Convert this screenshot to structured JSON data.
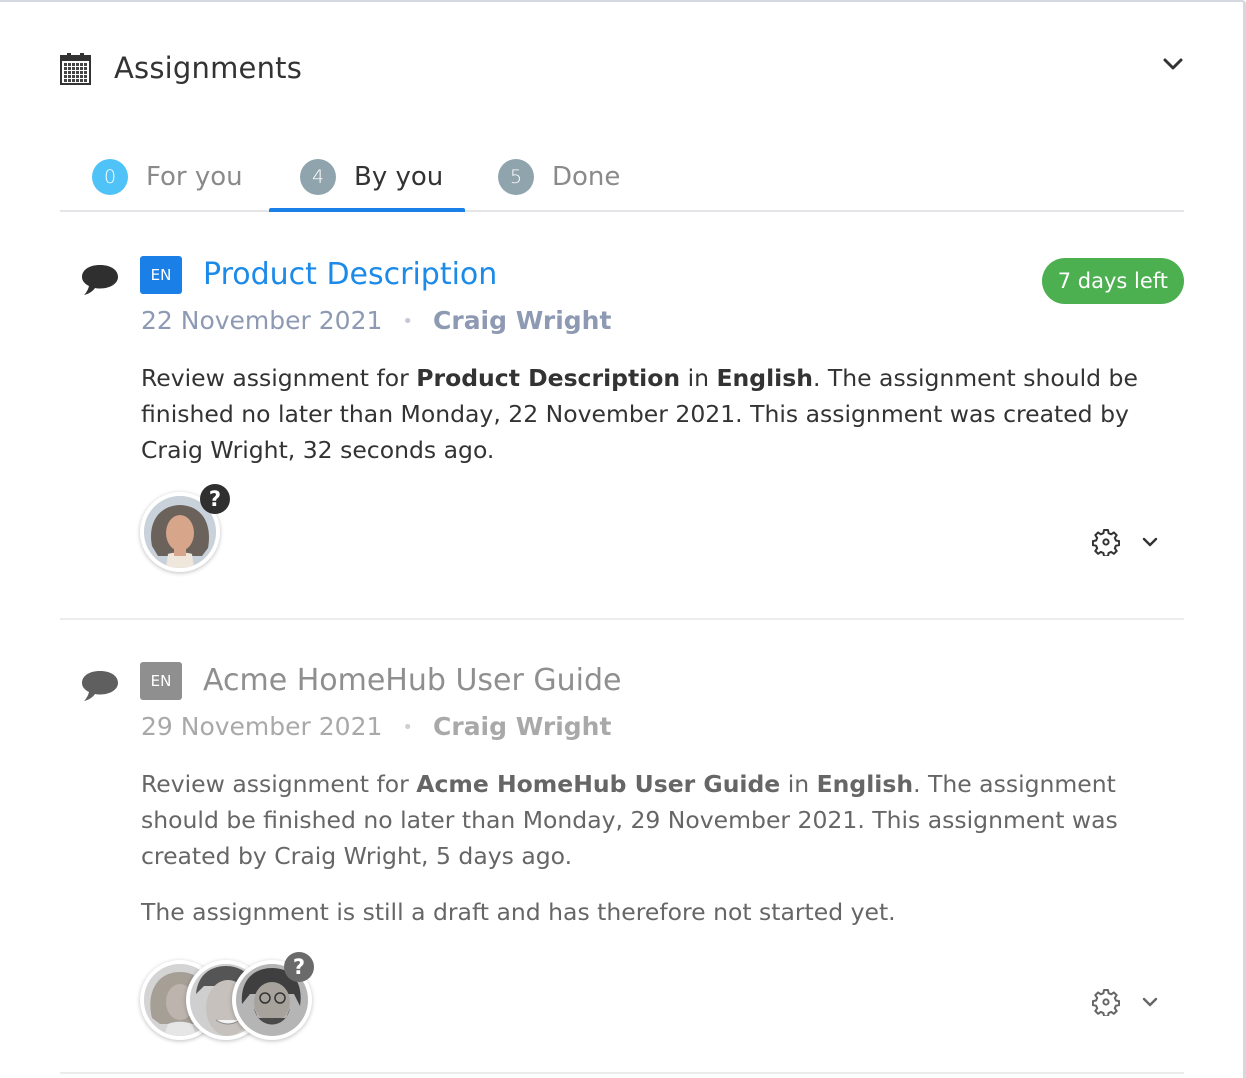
{
  "header": {
    "title": "Assignments",
    "icon": "calendar-icon",
    "collapse_icon": "chevron-down-icon"
  },
  "tabs": [
    {
      "label": "For you",
      "count": "0",
      "badge_color": "#4fc3f7",
      "active": false
    },
    {
      "label": "By you",
      "count": "4",
      "badge_color": "#90a4ae",
      "active": true
    },
    {
      "label": "Done",
      "count": "5",
      "badge_color": "#90a4ae",
      "active": false
    }
  ],
  "colors": {
    "accent": "#1b7fe8",
    "deadline_badge": "#4caf50",
    "active_lang_badge": "#1b7fe8",
    "draft_lang_badge": "#8f8f8f"
  },
  "assignments": [
    {
      "language_code": "EN",
      "title": "Product Description",
      "date": "22 November 2021",
      "separator": "•",
      "author": "Craig Wright",
      "deadline_label": "7 days left",
      "description": {
        "prefix": "Review assignment for ",
        "document": "Product Description",
        "middle": " in ",
        "language": "English",
        "suffix": ". The assignment should be finished no later than Monday, 22 November 2021. This assignment was created by Craig Wright, 32 seconds ago."
      },
      "status_note": "",
      "assignees": [
        {
          "name": "assignee-1",
          "status_icon": "question-icon"
        }
      ],
      "actions": {
        "settings_icon": "gear-icon",
        "expand_icon": "chevron-down-icon"
      },
      "state": "active"
    },
    {
      "language_code": "EN",
      "title": "Acme HomeHub User Guide",
      "date": "29 November 2021",
      "separator": "•",
      "author": "Craig Wright",
      "deadline_label": "",
      "description": {
        "prefix": "Review assignment for ",
        "document": "Acme HomeHub User Guide",
        "middle": " in ",
        "language": "English",
        "suffix": ". The assignment should be finished no later than Monday, 29 November 2021. This assignment was created by Craig Wright, 5 days ago."
      },
      "status_note": "The assignment is still a draft and has therefore not started yet.",
      "assignees": [
        {
          "name": "assignee-1"
        },
        {
          "name": "assignee-2"
        },
        {
          "name": "assignee-3",
          "status_icon": "question-icon"
        }
      ],
      "actions": {
        "settings_icon": "gear-icon",
        "expand_icon": "chevron-down-icon"
      },
      "state": "draft"
    }
  ]
}
